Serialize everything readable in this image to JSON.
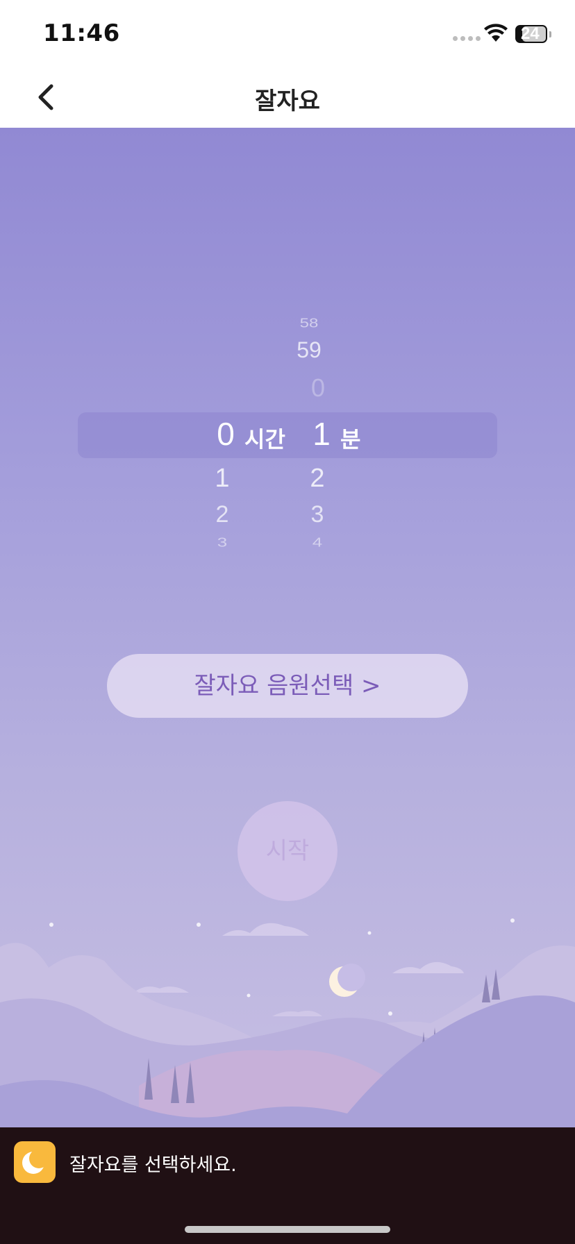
{
  "status_bar": {
    "time": "11:46",
    "battery": "24"
  },
  "nav": {
    "title": "잘자요"
  },
  "picker": {
    "minutes_above": [
      "58",
      "59",
      "0"
    ],
    "selected_hours": "0",
    "hours_label": "시간",
    "selected_minutes": "1",
    "minutes_label": "분",
    "hours_below": [
      "1",
      "2",
      "3"
    ],
    "minutes_below": [
      "2",
      "3",
      "4"
    ]
  },
  "sound_button": {
    "label": "잘자요 음원선택 >"
  },
  "start_button": {
    "label": "시작"
  },
  "bottom_bar": {
    "message": "잘자요를 선택하세요.",
    "icon": "moon-icon"
  },
  "colors": {
    "accent": "#7b5cb8",
    "background_top": "#9189d3",
    "bottom_bar": "#201014",
    "badge": "#f9b93d"
  }
}
